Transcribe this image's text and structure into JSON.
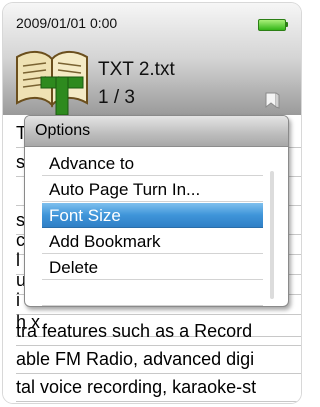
{
  "status": {
    "datetime": "2009/01/01  0:00",
    "battery_color": "#33b518"
  },
  "file": {
    "name": "TXT 2.txt",
    "page": "1 / 3"
  },
  "icons": {
    "book": "text-book-icon",
    "bookmark": "bookmark-icon",
    "battery": "battery-icon"
  },
  "reader": {
    "lines": [
      "T",
      "s",
      "",
      "s",
      "c",
      "l",
      "u",
      "i",
      "h                                  x",
      "tra features such as a Record",
      "able FM Radio, advanced digi",
      "tal voice recording, karaoke-st"
    ]
  },
  "options": {
    "title": "Options",
    "items": [
      "Advance to",
      "Auto Page Turn In...",
      "Font Size",
      "Add Bookmark",
      "Delete",
      "",
      ""
    ],
    "selected_index": 2,
    "highlight_color": "#3f95d9"
  }
}
